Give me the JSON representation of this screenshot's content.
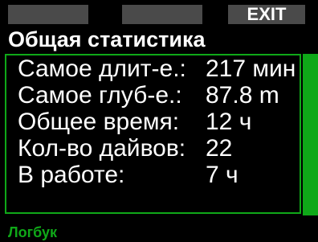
{
  "softkeys": {
    "left": "",
    "middle": "",
    "right": "EXIT"
  },
  "title": "Общая статистика",
  "stats": [
    {
      "label": "Самое длит-е.:",
      "value": "217 мин"
    },
    {
      "label": "Самое глуб-е.:",
      "value": "87.8 m"
    },
    {
      "label": "Общее время:",
      "value": "12 ч"
    },
    {
      "label": "Кол-во дайвов:",
      "value": "22"
    },
    {
      "label": "В работе:",
      "value": "7 ч"
    }
  ],
  "footer": "Логбук",
  "colors": {
    "accent": "#0fa818",
    "softkey_bg": "#4a4a4a",
    "background": "#000000",
    "text": "#ffffff"
  }
}
